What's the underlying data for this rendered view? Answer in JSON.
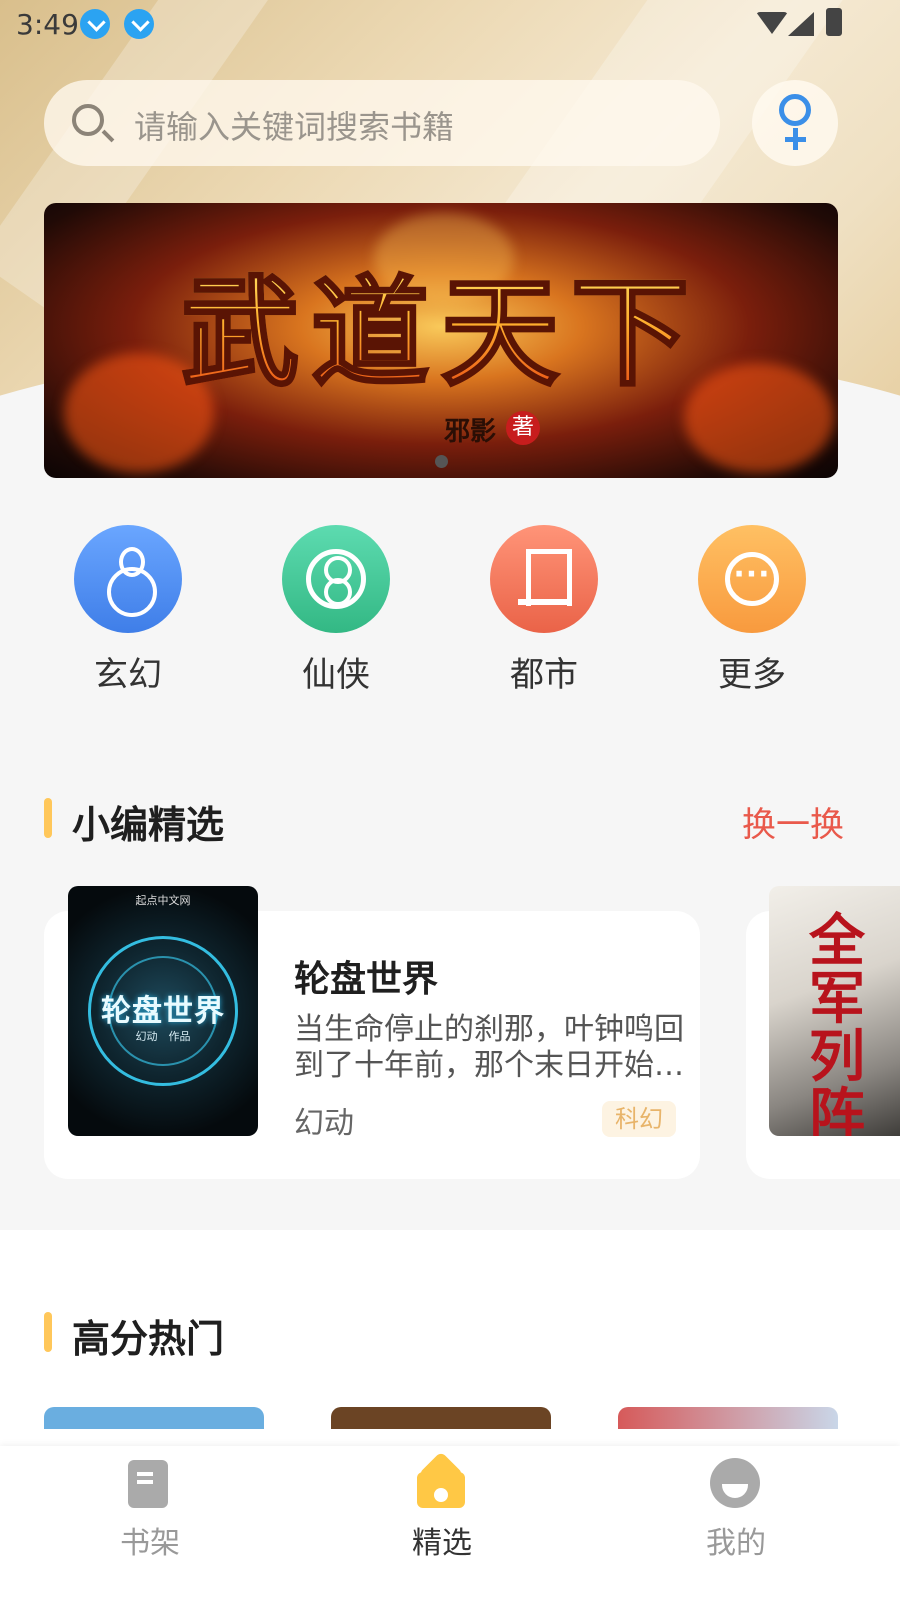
{
  "status_bar": {
    "time": "3:49"
  },
  "search": {
    "placeholder": "请输入关键词搜索书籍"
  },
  "banner": {
    "title": "武道天下",
    "author": "邪影",
    "seal": "著"
  },
  "categories": [
    {
      "label": "玄幻",
      "icon": "gourd-icon",
      "color": "#4f8ff2"
    },
    {
      "label": "仙侠",
      "icon": "yin-yang-icon",
      "color": "#47c89a"
    },
    {
      "label": "都市",
      "icon": "building-icon",
      "color": "#f07a5c"
    },
    {
      "label": "更多",
      "icon": "more-icon",
      "color": "#f9a24a"
    }
  ],
  "editor_picks": {
    "title": "小编精选",
    "refresh_label": "换一换",
    "book": {
      "cover_brand": "起点中文网",
      "cover_title": "轮盘世界",
      "cover_sub": "幻动　作品",
      "title": "轮盘世界",
      "description": "当生命停止的刹那，叶钟鸣回到了十年前，那个末日开始…",
      "author": "幻动",
      "tag": "科幻"
    },
    "next_book": {
      "cover_title": "全军列阵"
    }
  },
  "hot": {
    "title": "高分热门"
  },
  "tabs": [
    {
      "label": "书架",
      "icon": "bookshelf-icon",
      "active": false
    },
    {
      "label": "精选",
      "icon": "home-icon",
      "active": true
    },
    {
      "label": "我的",
      "icon": "profile-icon",
      "active": false
    }
  ],
  "colors": {
    "accent": "#ffc75a",
    "refresh": "#e9594b",
    "tab_active": "#333333",
    "tab_inactive": "#999999"
  }
}
